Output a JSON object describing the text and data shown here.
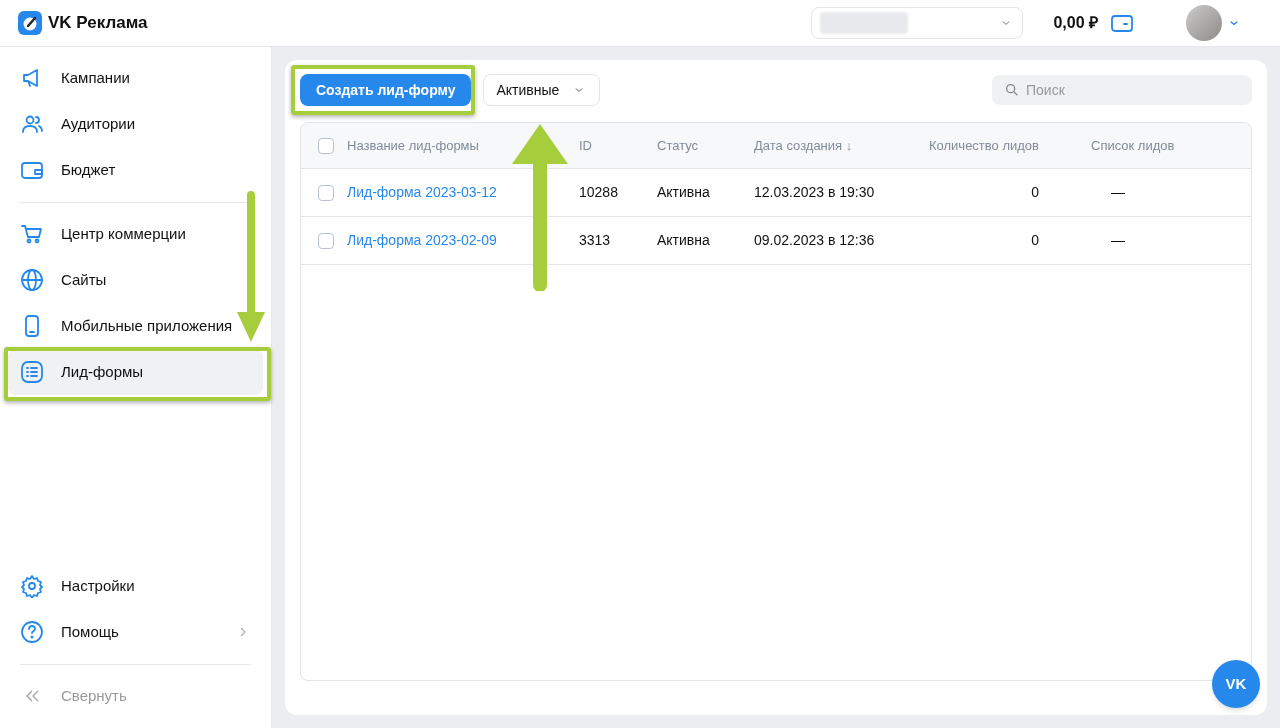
{
  "header": {
    "logo_text": "VK Реклама",
    "balance": "0,00 ₽"
  },
  "sidebar": {
    "groups": [
      [
        {
          "label": "Кампании",
          "selected": false,
          "submenu": false
        },
        {
          "label": "Аудитории",
          "selected": false,
          "submenu": false
        },
        {
          "label": "Бюджет",
          "selected": false,
          "submenu": false
        }
      ],
      [
        {
          "label": "Центр коммерции",
          "selected": false,
          "submenu": false
        },
        {
          "label": "Сайты",
          "selected": false,
          "submenu": false
        },
        {
          "label": "Мобильные приложения",
          "selected": false,
          "submenu": false
        },
        {
          "label": "Лид-формы",
          "selected": true,
          "submenu": false
        }
      ]
    ],
    "bottom_items": [
      {
        "label": "Настройки",
        "selected": false,
        "submenu": false
      },
      {
        "label": "Помощь",
        "selected": false,
        "submenu": true
      }
    ],
    "collapse": "Свернуть"
  },
  "toolbar": {
    "create_button": "Создать лид-форму",
    "filter": "Активные",
    "search": {
      "placeholder": "Поиск"
    }
  },
  "table": {
    "header_checked": false,
    "columns": [
      "Название лид-формы",
      "ID",
      "Статус",
      "Дата создания ↓",
      "Количество лидов",
      "Список лидов"
    ],
    "rows": [
      {
        "checked": false,
        "name": "Лид-форма 2023-03-12",
        "id": "10288",
        "status": "Активна",
        "created": "12.03.2023 в 19:30",
        "leads_count": "0",
        "leads_list": "—"
      },
      {
        "checked": false,
        "name": "Лид-форма 2023-02-09",
        "id": "3313",
        "status": "Активна",
        "created": "09.02.2023 в 12:36",
        "leads_count": "0",
        "leads_list": "—"
      }
    ]
  },
  "chat_button": "VK"
}
